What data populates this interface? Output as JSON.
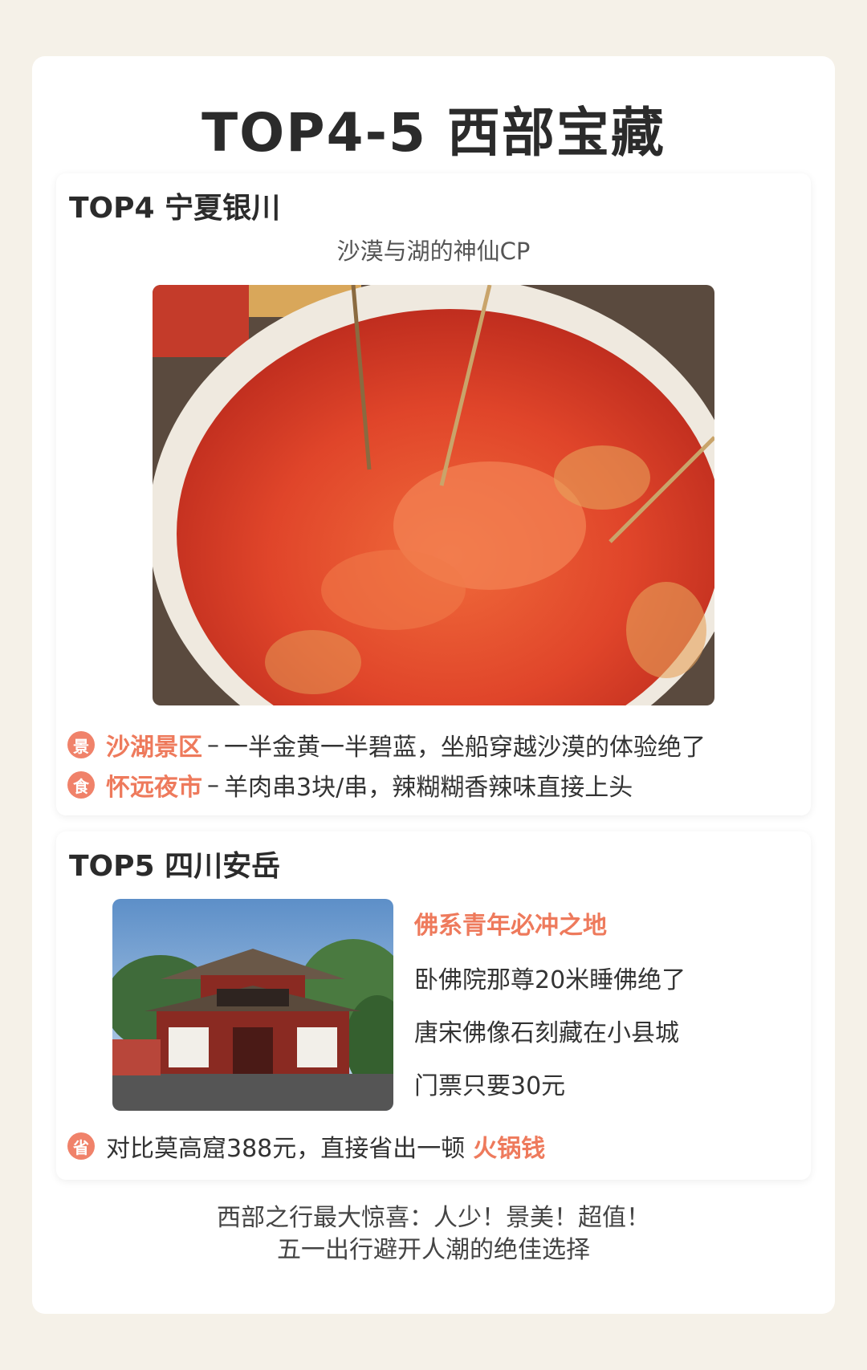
{
  "title": "TOP4-5 西部宝藏",
  "sections": [
    {
      "title": "TOP4 宁夏银川",
      "subtitle": "沙漠与湖的神仙CP",
      "photo": "spicy-hotpot-photo",
      "items": [
        {
          "badge": "景",
          "name": "沙湖景区",
          "sep": "–",
          "desc": "一半金黄一半碧蓝，坐船穿越沙漠的体验绝了"
        },
        {
          "badge": "食",
          "name": "怀远夜市",
          "sep": "–",
          "desc": "羊肉串3块/串，辣糊糊香辣味直接上头"
        }
      ]
    },
    {
      "title": "TOP5 四川安岳",
      "photo": "temple-photo",
      "headline": "佛系青年必冲之地",
      "lines": [
        "卧佛院那尊20米睡佛绝了",
        "唐宋佛像石刻藏在小县城",
        "门票只要30元"
      ],
      "note": {
        "badge": "省",
        "text": "对比莫高窟388元，直接省出一顿",
        "highlight": "火锅钱"
      }
    }
  ],
  "footer": [
    "西部之行最大惊喜：人少！景美！超值！",
    "五一出行避开人潮的绝佳选择"
  ],
  "colors": {
    "accent": "#ee7a5c",
    "background": "#f5f1e8"
  }
}
